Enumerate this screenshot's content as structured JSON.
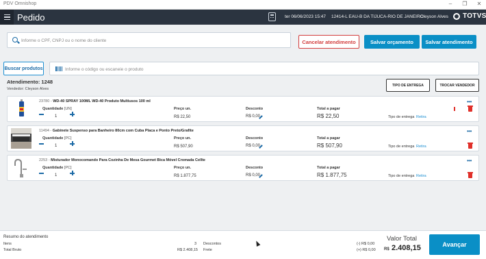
{
  "window": {
    "title": "PDV Omnishop"
  },
  "header": {
    "title": "Pedido",
    "datetime": "ter 06/06/2023 15:47",
    "store": "12414-L EAU-B DA TIJUCA-RIO DE JANEIRO",
    "user": "Cleyson Alves",
    "logo": "TOTVS"
  },
  "client_search": {
    "placeholder": "Informe o CPF, CNPJ ou o nome do cliente"
  },
  "actions": {
    "cancel": "Cancelar atendimento",
    "save_quote": "Salvar orçamento",
    "save_service": "Salvar atendimento"
  },
  "product_search": {
    "button": "Buscar produtos",
    "placeholder": "Informe o código ou escaneie o produto"
  },
  "attendance": {
    "title": "Atendimento: 1248",
    "seller": "Vendedor: Cleyson Alves",
    "delivery_type_button": "TIPO DE ENTREGA",
    "change_seller_button": "TROCAR VENDEDOR"
  },
  "labels": {
    "quantity": "Quantidade",
    "unit_price": "Preço un.",
    "discount": "Desconto",
    "total": "Total a pagar",
    "delivery_type": "Tipo de entrega"
  },
  "items": [
    {
      "code": "23780",
      "name": "WD-40 SPRAY 100ML WD-40 Produto Multiusos 100 ml",
      "unit": "[UN]",
      "qty": "1",
      "unit_price": "R$ 22,50",
      "discount": "R$ 0,00",
      "total": "R$ 22,50",
      "delivery": "Retira",
      "thumb": "wd40-can"
    },
    {
      "code": "11494",
      "name": "Gabinete Suspenso para Banheiro 80cm com Cuba Placa e Ponto Preto/Grafite",
      "unit": "[PC]",
      "qty": "1",
      "unit_price": "R$ 507,90",
      "discount": "R$ 0,00",
      "total": "R$ 507,90",
      "delivery": "Retira",
      "thumb": "bathroom-cabinet"
    },
    {
      "code": "2253",
      "name": "Misturador Monocomando Para Cozinha De Mesa Gourmet Bica Móvel Cromada Cellte",
      "unit": "[PC]",
      "qty": "1",
      "unit_price": "R$ 1.877,75",
      "discount": "R$ 0,00",
      "total": "R$ 1.877,75",
      "delivery": "Retira",
      "thumb": "kitchen-faucet"
    }
  ],
  "summary": {
    "title": "Resumo do atendimento",
    "items_label": "Itens",
    "items_count": "3",
    "gross_label": "Total Bruto",
    "gross_value": "R$ 2.408,15",
    "discounts_label": "Descontos",
    "discounts_value": "(-) R$ 0,00",
    "freight_label": "Frete",
    "freight_value": "(+) R$ 0,00",
    "total_label": "Valor Total",
    "currency": "R$",
    "total_value": "2.408,15",
    "advance_button": "Avançar"
  },
  "colors": {
    "header_bg": "#2b3440",
    "accent": "#0a8fc6",
    "danger": "#d23c3c"
  }
}
